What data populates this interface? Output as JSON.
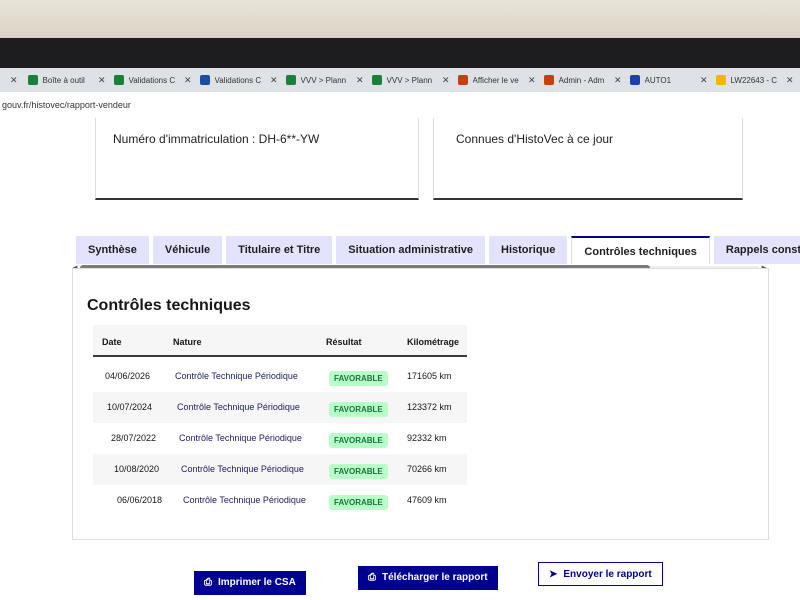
{
  "browser": {
    "tabs": [
      {
        "title": "Boîte à outil",
        "favicon_color": "#188038"
      },
      {
        "title": "Validations C",
        "favicon_color": "#188038"
      },
      {
        "title": "Validations C",
        "favicon_color": "#1a4f9c"
      },
      {
        "title": "VVV > Plann",
        "favicon_color": "#188038"
      },
      {
        "title": "VVV > Plann",
        "favicon_color": "#188038"
      },
      {
        "title": "Afficher le ve",
        "favicon_color": "#c2410c"
      },
      {
        "title": "Admin - Adm",
        "favicon_color": "#c2410c"
      },
      {
        "title": "AUTO1",
        "favicon_color": "#1e40af"
      },
      {
        "title": "LW22643 - C",
        "favicon_color": "#f4b400"
      }
    ],
    "url": "gouv.fr/histovec/rapport-vendeur"
  },
  "info": {
    "immat": "Numéro d'immatriculation : DH-6**-YW",
    "connues": "Connues d'HistoVec à ce jour"
  },
  "tabs": [
    "Synthèse",
    "Véhicule",
    "Titulaire et Titre",
    "Situation administrative",
    "Historique",
    "Contrôles techniques",
    "Rappels constru"
  ],
  "active_tab": "Contrôles techniques",
  "section_title": "Contrôles techniques",
  "table": {
    "headers": {
      "date": "Date",
      "nature": "Nature",
      "resultat": "Résultat",
      "km": "Kilométrage"
    },
    "rows": [
      {
        "date": "04/06/2026",
        "nature": "Contrôle Technique Périodique",
        "resultat": "FAVORABLE",
        "km": "171605 km"
      },
      {
        "date": "10/07/2024",
        "nature": "Contrôle Technique Périodique",
        "resultat": "FAVORABLE",
        "km": "123372 km"
      },
      {
        "date": "28/07/2022",
        "nature": "Contrôle Technique Périodique",
        "resultat": "FAVORABLE",
        "km": "92332 km"
      },
      {
        "date": "10/08/2020",
        "nature": "Contrôle Technique Périodique",
        "resultat": "FAVORABLE",
        "km": "70266 km"
      },
      {
        "date": "06/06/2018",
        "nature": "Contrôle Technique Périodique",
        "resultat": "FAVORABLE",
        "km": "47609 km"
      }
    ]
  },
  "buttons": {
    "imprimer": "Imprimer le CSA",
    "telecharger": "Télécharger le rapport",
    "envoyer": "Envoyer le rapport"
  },
  "colors": {
    "primary": "#000091",
    "badge_bg": "#b8fec9",
    "badge_text": "#18753c"
  }
}
